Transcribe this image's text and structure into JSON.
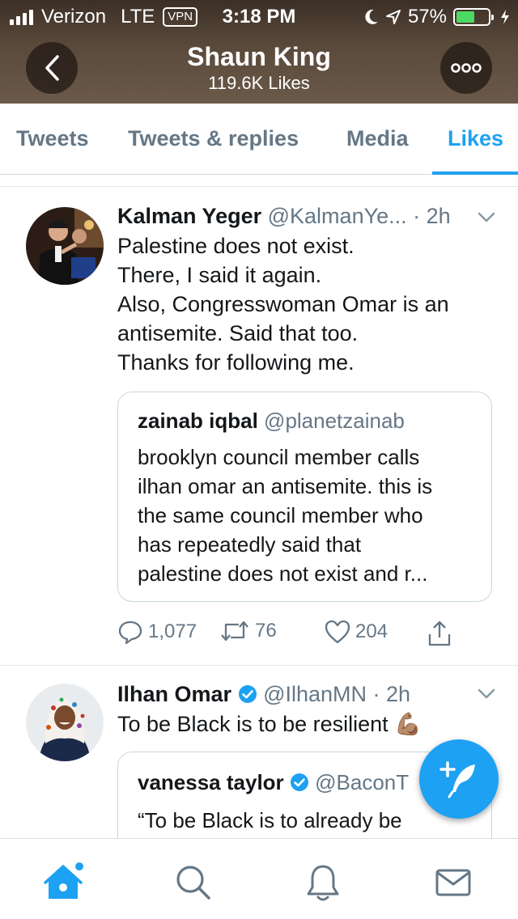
{
  "status_bar": {
    "carrier": "Verizon",
    "network": "LTE",
    "vpn": "VPN",
    "time": "3:18 PM",
    "battery": "57%",
    "battery_level": 0.57
  },
  "header": {
    "name": "Shaun King",
    "likes": "119.6K Likes"
  },
  "tabs": [
    {
      "label": "Tweets"
    },
    {
      "label": "Tweets & replies"
    },
    {
      "label": "Media"
    },
    {
      "label": "Likes",
      "active": true
    }
  ],
  "tweets": [
    {
      "name": "Kalman Yeger",
      "handle": "@KalmanYe...",
      "time": "· 2h",
      "lines": [
        "Palestine does not exist.",
        "There, I said it again.",
        "Also, Congresswoman Omar is an",
        "antisemite.  Said that too.",
        "Thanks for following me."
      ],
      "quote": {
        "name": "zainab iqbal",
        "handle": "@planetzainab",
        "lines": [
          "brooklyn council member calls",
          "ilhan omar an antisemite. this is",
          "the same council member who",
          "has repeatedly said that",
          "palestine does not exist and r..."
        ]
      },
      "replies": "1,077",
      "retweets": "76",
      "likes": "204"
    },
    {
      "name": "Ilhan Omar",
      "handle": "@IlhanMN",
      "time": "· 2h",
      "text": "To be Black is to be resilient",
      "emoji": "💪🏽",
      "quote": {
        "name": "vanessa taylor",
        "handle": "@BaconT",
        "text": "“To be Black is to already be"
      }
    }
  ],
  "colors": {
    "accent": "#1da1f2",
    "muted": "#657786",
    "text": "#14171a"
  },
  "nav": [
    "home-icon",
    "search-icon",
    "notifications-icon",
    "messages-icon"
  ]
}
